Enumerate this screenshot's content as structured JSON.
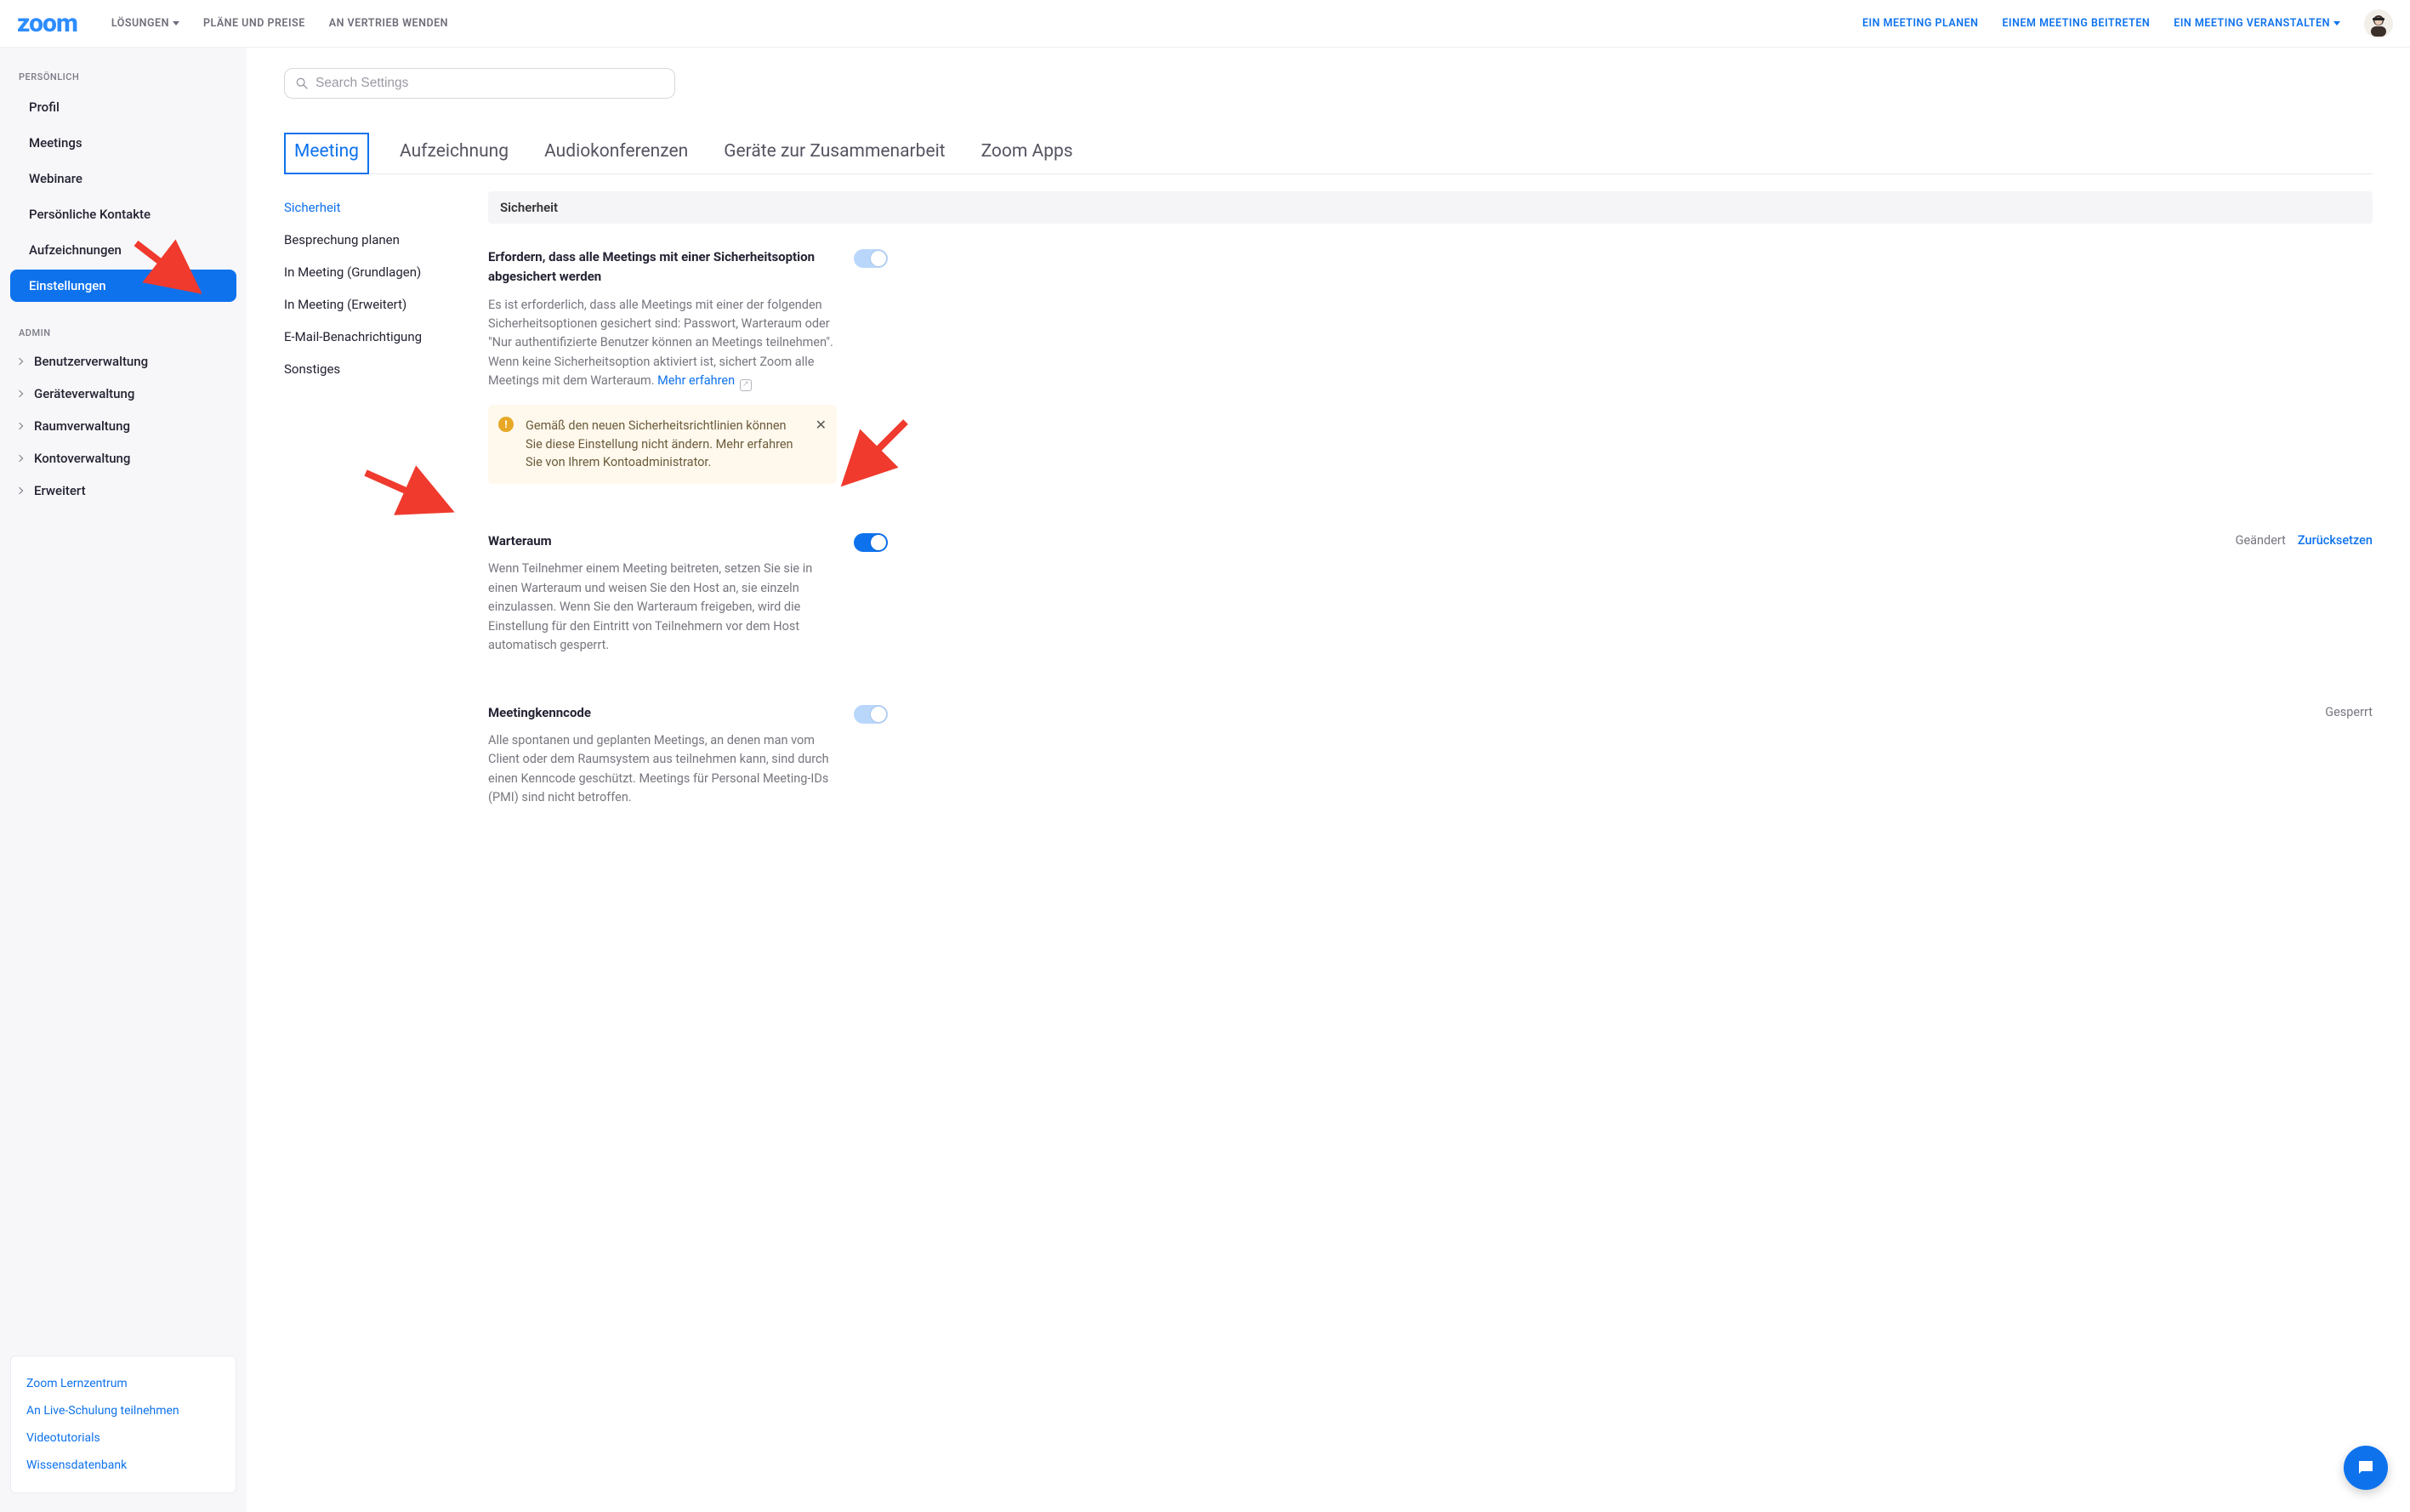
{
  "topnav": {
    "logo": "zoom",
    "left": [
      {
        "label": "LÖSUNGEN",
        "dropdown": true
      },
      {
        "label": "PLÄNE UND PREISE",
        "dropdown": false
      },
      {
        "label": "AN VERTRIEB WENDEN",
        "dropdown": false
      }
    ],
    "right": [
      {
        "label": "EIN MEETING PLANEN",
        "dropdown": false
      },
      {
        "label": "EINEM MEETING BEITRETEN",
        "dropdown": false
      },
      {
        "label": "EIN MEETING VERANSTALTEN",
        "dropdown": true
      }
    ]
  },
  "sidebar": {
    "personal_label": "PERSÖNLICH",
    "personal": [
      {
        "label": "Profil",
        "active": false
      },
      {
        "label": "Meetings",
        "active": false
      },
      {
        "label": "Webinare",
        "active": false
      },
      {
        "label": "Persönliche Kontakte",
        "active": false
      },
      {
        "label": "Aufzeichnungen",
        "active": false
      },
      {
        "label": "Einstellungen",
        "active": true
      }
    ],
    "admin_label": "ADMIN",
    "admin": [
      {
        "label": "Benutzerverwaltung"
      },
      {
        "label": "Geräteverwaltung"
      },
      {
        "label": "Raumverwaltung"
      },
      {
        "label": "Kontoverwaltung"
      },
      {
        "label": "Erweitert"
      }
    ],
    "footer": [
      {
        "label": "Zoom Lernzentrum"
      },
      {
        "label": "An Live-Schulung teilnehmen"
      },
      {
        "label": "Videotutorials"
      },
      {
        "label": "Wissensdatenbank"
      }
    ]
  },
  "search": {
    "placeholder": "Search Settings"
  },
  "tabs": [
    {
      "label": "Meeting",
      "active": true
    },
    {
      "label": "Aufzeichnung",
      "active": false
    },
    {
      "label": "Audiokonferenzen",
      "active": false
    },
    {
      "label": "Geräte zur Zusammenarbeit",
      "active": false
    },
    {
      "label": "Zoom Apps",
      "active": false
    }
  ],
  "subnav": [
    {
      "label": "Sicherheit",
      "active": true
    },
    {
      "label": "Besprechung planen",
      "active": false
    },
    {
      "label": "In Meeting (Grundlagen)",
      "active": false
    },
    {
      "label": "In Meeting (Erweitert)",
      "active": false
    },
    {
      "label": "E-Mail-Benachrichtigung",
      "active": false
    },
    {
      "label": "Sonstiges",
      "active": false
    }
  ],
  "section_header": "Sicherheit",
  "settings": {
    "secure_meetings": {
      "title": "Erfordern, dass alle Meetings mit einer Sicherheitsoption abgesichert werden",
      "desc_pre": "Es ist erforderlich, dass alle Meetings mit einer der folgenden Sicherheitsoptionen gesichert sind: Passwort, Warteraum oder \"Nur authentifizierte Benutzer können an Meetings teilnehmen\". Wenn keine Sicherheitsoption aktiviert ist, sichert Zoom alle Meetings mit dem Warteraum. ",
      "learn_more": "Mehr erfahren",
      "toggle_state": "locked-on",
      "banner": "Gemäß den neuen Sicherheitsrichtlinien können Sie diese Einstellung nicht ändern. Mehr erfahren Sie von Ihrem Kontoadministrator."
    },
    "waiting_room": {
      "title": "Warteraum",
      "desc": "Wenn Teilnehmer einem Meeting beitreten, setzen Sie sie in einen Warteraum und weisen Sie den Host an, sie einzeln einzulassen. Wenn Sie den Warteraum freigeben, wird die Einstellung für den Eintritt von Teilnehmern vor dem Host automatisch gesperrt.",
      "toggle_state": "on",
      "status_text": "Geändert",
      "reset_link": "Zurücksetzen"
    },
    "passcode": {
      "title": "Meetingkenncode",
      "desc": "Alle spontanen und geplanten Meetings, an denen man vom Client oder dem Raumsystem aus teilnehmen kann, sind durch einen Kenncode geschützt. Meetings für Personal Meeting-IDs (PMI) sind nicht betroffen.",
      "toggle_state": "locked-on",
      "status_text": "Gesperrt"
    }
  }
}
